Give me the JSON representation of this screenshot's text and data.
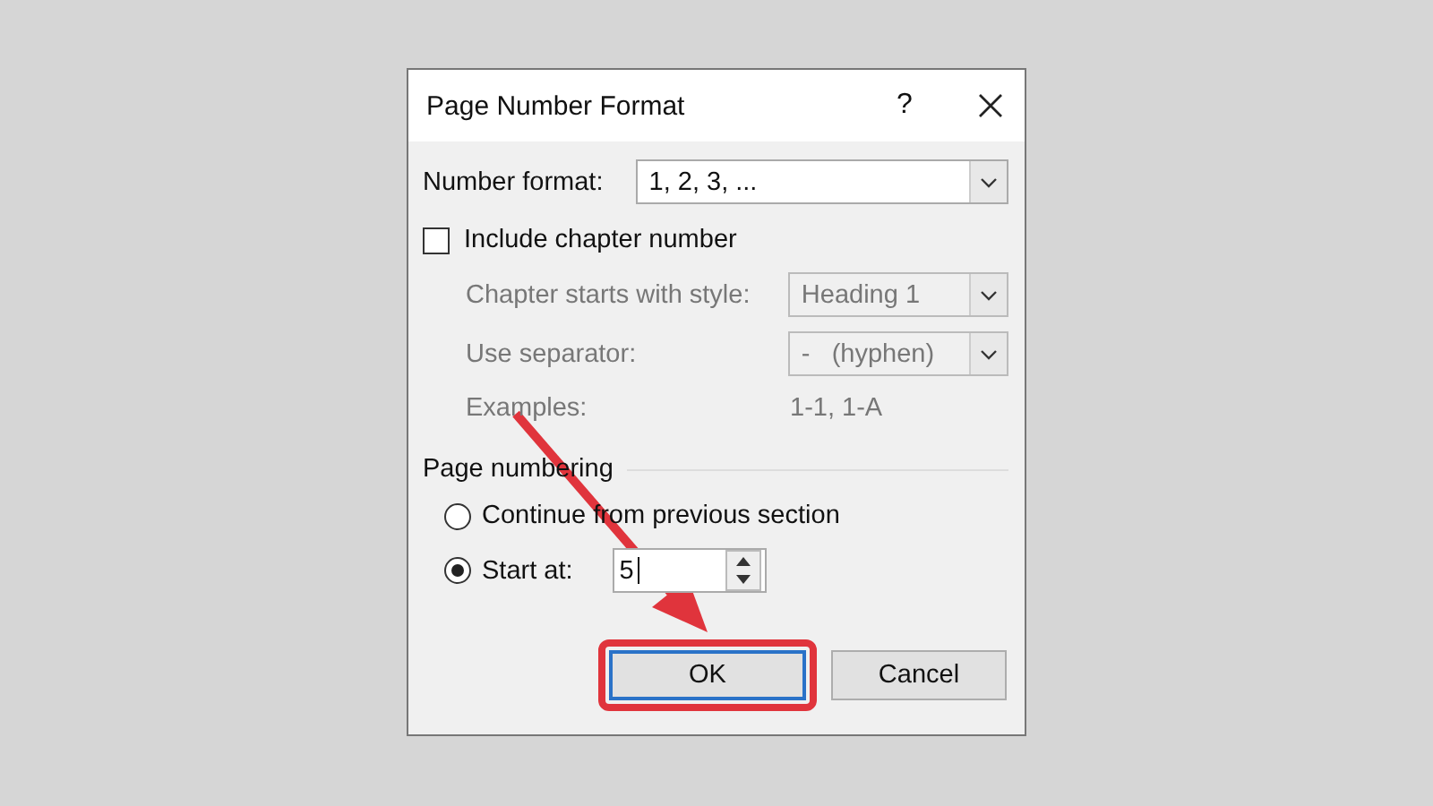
{
  "window": {
    "title": "Page Number Format",
    "help": "?"
  },
  "number_format": {
    "label": "Number format:",
    "value": "1, 2, 3, ..."
  },
  "include_chapter": {
    "label": "Include chapter number",
    "checked": false
  },
  "chapter_fields": [
    {
      "label": "Chapter starts with style:",
      "value": "Heading 1",
      "disabled": true
    },
    {
      "label": "Use separator:",
      "value": "-   (hyphen)",
      "disabled": true
    }
  ],
  "examples": {
    "label": "Examples:",
    "value": "1-1, 1-A",
    "disabled": true
  },
  "page_numbering": {
    "title": "Page numbering",
    "options": [
      {
        "label": "Continue from previous section",
        "selected": false
      },
      {
        "label": "Start at:",
        "selected": true
      }
    ],
    "start_at": "5"
  },
  "buttons": [
    {
      "label": "OK",
      "highlighted": true
    },
    {
      "label": "Cancel",
      "highlighted": false
    }
  ]
}
